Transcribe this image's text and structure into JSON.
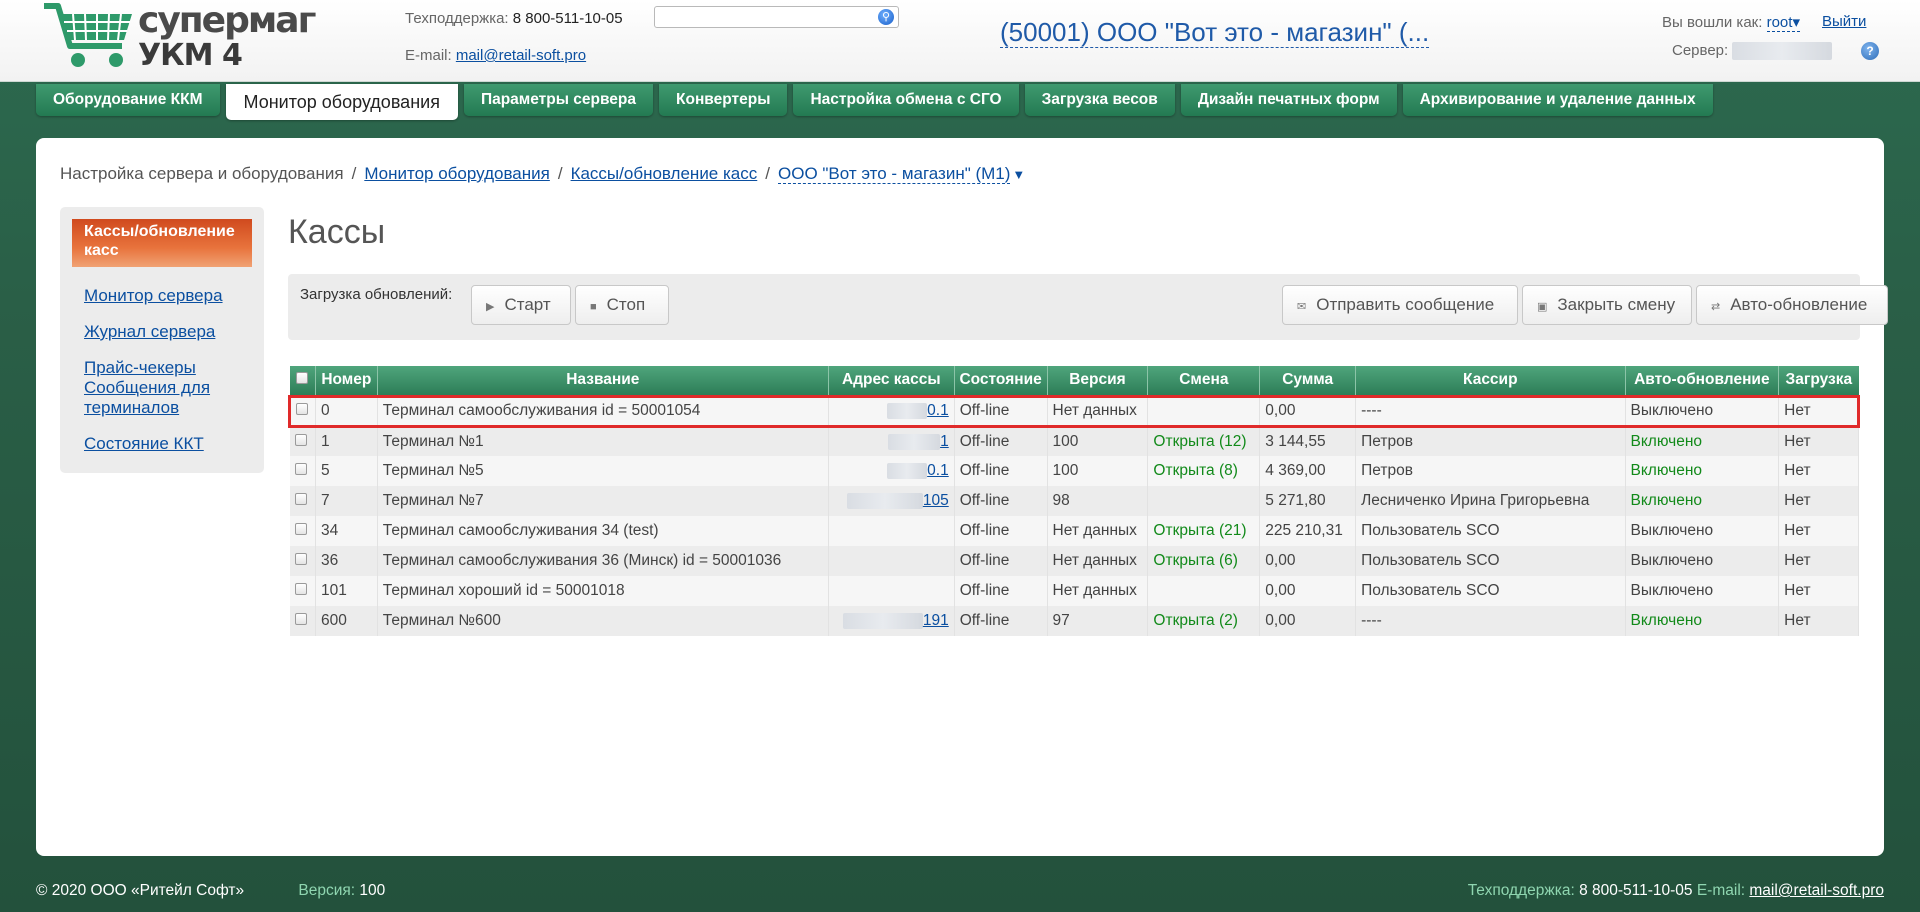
{
  "brand": {
    "name": "супермаг",
    "sub": "УКМ 4"
  },
  "header": {
    "support_label": "Техподдержка:",
    "support_phone": "8 800-511-10-05",
    "email_label": "E-mail:",
    "email": "mail@retail-soft.pro",
    "search_placeholder": "",
    "store_title": "(50001) ООО \"Вот это - магазин\" (...",
    "login_label": "Вы вошли как:",
    "login_user": "root",
    "logout": "Выйти",
    "server_label": "Сервер:"
  },
  "nav": {
    "tabs": [
      {
        "label": "Оборудование ККМ"
      },
      {
        "label": "Монитор оборудования",
        "active": true
      },
      {
        "label": "Параметры сервера"
      },
      {
        "label": "Конвертеры"
      },
      {
        "label": "Настройка обмена с СГО"
      },
      {
        "label": "Загрузка весов"
      },
      {
        "label": "Дизайн печатных форм"
      },
      {
        "label": "Архивирование и удаление данных"
      }
    ]
  },
  "breadcrumb": {
    "root": "Настройка сервера и оборудования",
    "monitor": "Монитор оборудования",
    "cashes": "Кассы/обновление касс",
    "store": "ООО \"Вот это - магазин\" (М1)"
  },
  "sidebar": {
    "active": "Кассы/обновление касс",
    "items": [
      "Монитор сервера",
      "Журнал сервера",
      "Прайс-чекеры",
      "Сообщения для терминалов",
      "Состояние ККТ"
    ]
  },
  "page_title": "Кассы",
  "toolbar": {
    "label": "Загрузка обновлений:",
    "start": "Старт",
    "stop": "Стоп",
    "send_message": "Отправить сообщение",
    "close_shift": "Закрыть смену",
    "auto_update": "Авто-обновление"
  },
  "table": {
    "columns": [
      "Номер",
      "Название",
      "Адрес кассы",
      "Состояние",
      "Версия",
      "Смена",
      "Сумма",
      "Кассир",
      "Авто-обновление",
      "Загрузка"
    ],
    "rows": [
      {
        "num": "0",
        "name": "Терминал самообслуживания id = 50001054",
        "addr": "0.1",
        "state": "Off-line",
        "version": "Нет данных",
        "shift": "",
        "sum": "0,00",
        "cashier": "----",
        "auto": "Выключено",
        "load": "Нет"
      },
      {
        "num": "1",
        "name": "Терминал №1",
        "addr": "1",
        "state": "Off-line",
        "version": "100",
        "shift": "Открыта (12)",
        "sum": "3 144,55",
        "cashier": "Петров",
        "auto": "Включено",
        "load": "Нет"
      },
      {
        "num": "5",
        "name": "Терминал №5",
        "addr": "0.1",
        "state": "Off-line",
        "version": "100",
        "shift": "Открыта (8)",
        "sum": "4 369,00",
        "cashier": "Петров",
        "auto": "Включено",
        "load": "Нет"
      },
      {
        "num": "7",
        "name": "Терминал №7",
        "addr": "105",
        "state": "Off-line",
        "version": "98",
        "shift": "",
        "sum": "5 271,80",
        "cashier": "Лесниченко Ирина Григорьевна",
        "auto": "Включено",
        "load": "Нет"
      },
      {
        "num": "34",
        "name": "Терминал самообслуживания 34 (test)",
        "addr": "",
        "state": "Off-line",
        "version": "Нет данных",
        "shift": "Открыта (21)",
        "sum": "225 210,31",
        "cashier": "Пользователь SCO",
        "auto": "Выключено",
        "load": "Нет"
      },
      {
        "num": "36",
        "name": "Терминал самообслуживания 36 (Минск) id = 50001036",
        "addr": "",
        "state": "Off-line",
        "version": "Нет данных",
        "shift": "Открыта (6)",
        "sum": "0,00",
        "cashier": "Пользователь SCO",
        "auto": "Выключено",
        "load": "Нет"
      },
      {
        "num": "101",
        "name": "Терминал хороший id = 50001018",
        "addr": "",
        "state": "Off-line",
        "version": "Нет данных",
        "shift": "",
        "sum": "0,00",
        "cashier": "Пользователь SCO",
        "auto": "Выключено",
        "load": "Нет"
      },
      {
        "num": "600",
        "name": "Терминал №600",
        "addr": "191",
        "state": "Off-line",
        "version": "97",
        "shift": "Открыта (2)",
        "sum": "0,00",
        "cashier": "----",
        "auto": "Включено",
        "load": "Нет"
      }
    ]
  },
  "footer": {
    "copyright": "© 2020 ООО «Ритейл Софт»",
    "version_label": "Версия:",
    "version": "100",
    "support_label": "Техподдержка:",
    "support_phone": "8 800-511-10-05",
    "email_label": "E-mail:",
    "email": "mail@retail-soft.pro"
  },
  "colors": {
    "accent_green": "#2d7d57",
    "link": "#0b4fa0",
    "active_orange": "#e8733c",
    "status_green": "#128a1a",
    "highlight_red": "#e02a2a"
  }
}
